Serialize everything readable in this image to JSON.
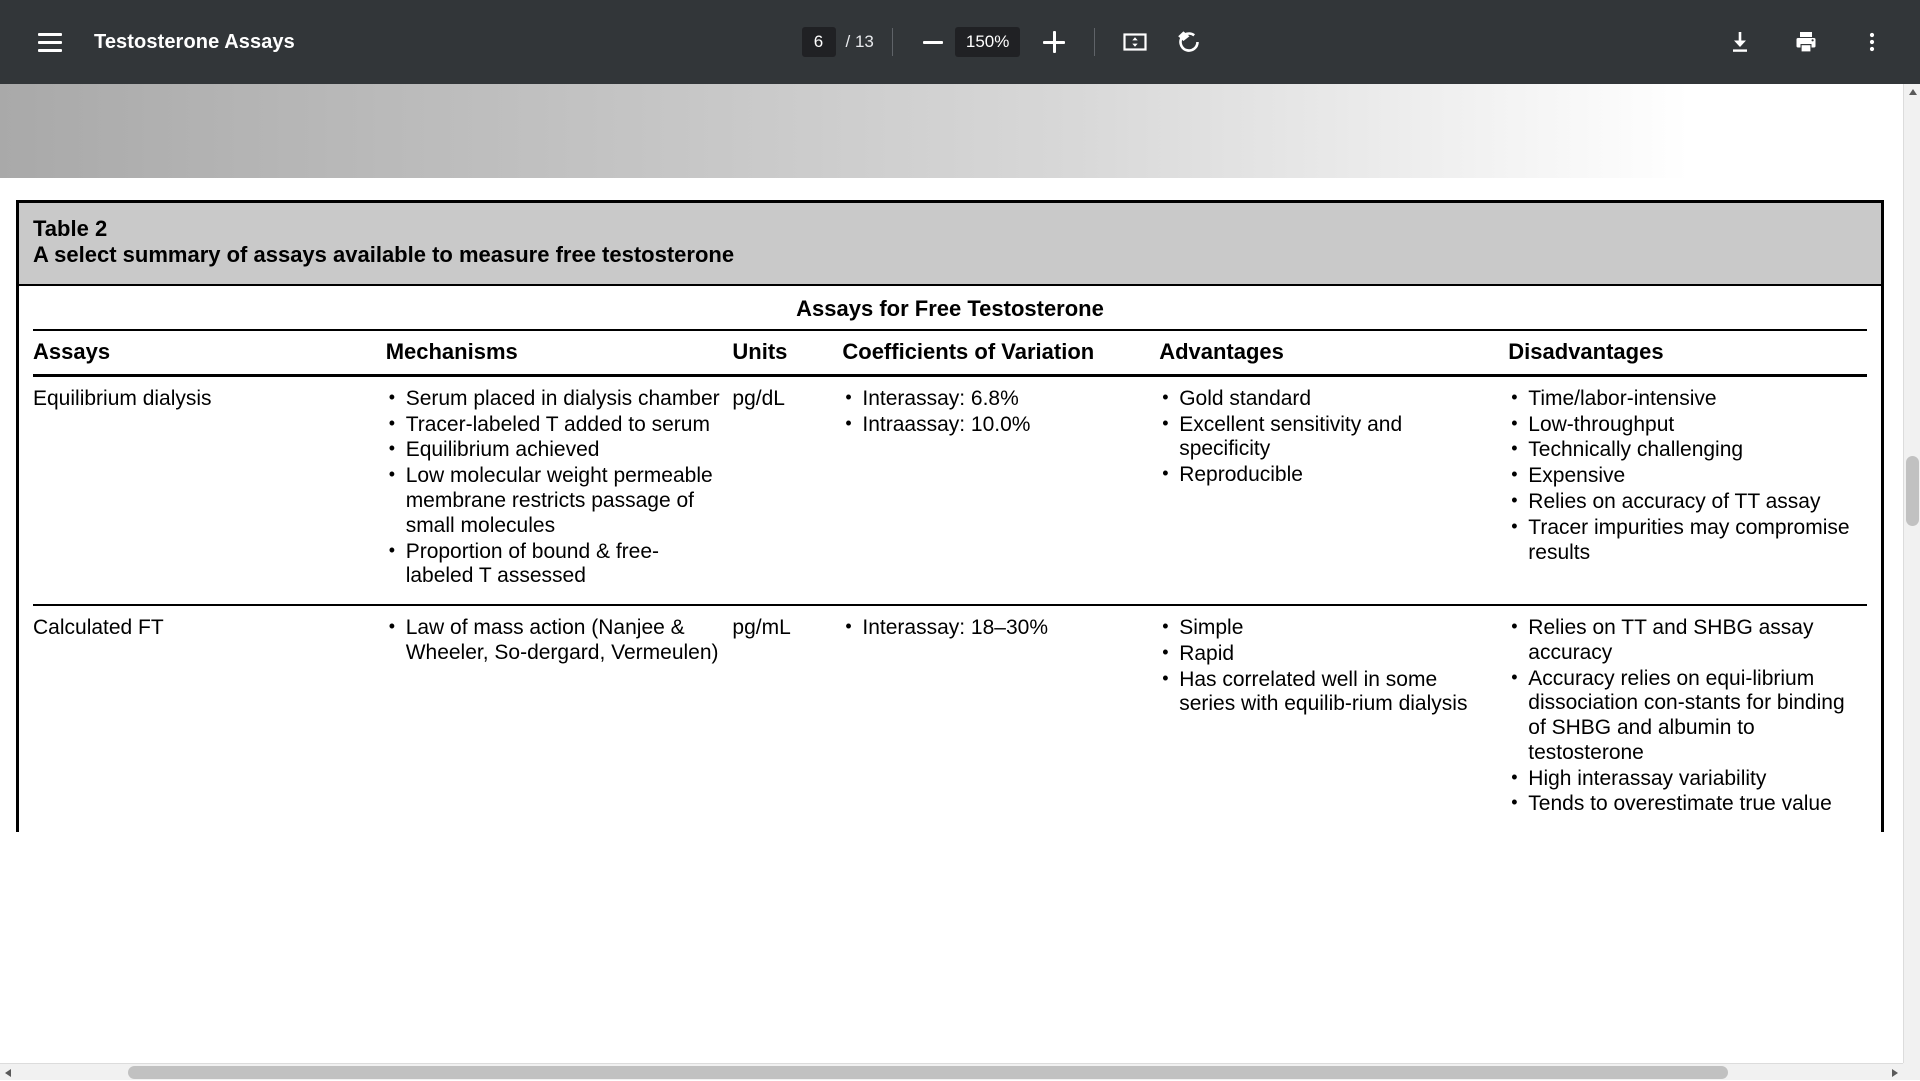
{
  "toolbar": {
    "menu_icon": "hamburger-menu-icon",
    "title": "Testosterone Assays",
    "page_current": "6",
    "page_total": "/ 13",
    "zoom_out_icon": "minus-icon",
    "zoom_level": "150%",
    "zoom_in_icon": "plus-icon",
    "fit_page_icon": "fit-to-page-icon",
    "rotate_icon": "rotate-counterclockwise-icon",
    "download_icon": "download-icon",
    "print_icon": "print-icon",
    "more_icon": "more-options-icon"
  },
  "document": {
    "table": {
      "label": "Table 2",
      "caption": "A select summary of assays available to measure free testosterone",
      "span_header": "Assays for Free Testosterone",
      "columns": [
        "Assays",
        "Mechanisms",
        "Units",
        "Coefficients of Variation",
        "Advantages",
        "Disadvantages"
      ],
      "rows": [
        {
          "assay": "Equilibrium dialysis",
          "mechanisms": [
            "Serum placed in dialysis chamber",
            "Tracer-labeled T added to serum",
            "Equilibrium achieved",
            "Low molecular weight permeable membrane restricts passage of small molecules",
            "Proportion of bound & free-labeled T assessed"
          ],
          "units": "pg/dL",
          "cv": [
            "Interassay: 6.8%",
            "Intraassay: 10.0%"
          ],
          "advantages": [
            "Gold standard",
            "Excellent sensitivity and specificity",
            "Reproducible"
          ],
          "disadvantages": [
            "Time/labor-intensive",
            "Low-throughput",
            "Technically challenging",
            "Expensive",
            "Relies on accuracy of TT assay",
            "Tracer impurities may compromise results"
          ]
        },
        {
          "assay": "Calculated FT",
          "mechanisms": [
            "Law of mass action (Nanjee & Wheeler, So-dergard, Vermeulen)"
          ],
          "units": "pg/mL",
          "cv": [
            "Interassay: 18–30%"
          ],
          "advantages": [
            "Simple",
            "Rapid",
            "Has correlated well in some series with equilib-rium dialysis"
          ],
          "disadvantages": [
            "Relies on TT and SHBG assay accuracy",
            "Accuracy relies on equi-librium dissociation con-stants for binding of SHBG and albumin to testosterone",
            "High interassay variability",
            "Tends to overestimate true value"
          ]
        }
      ]
    }
  },
  "colors": {
    "toolbar_bg": "#323639",
    "caption_bg": "#c9c9c9",
    "page_bg": "#ffffff",
    "rule": "#000000"
  }
}
